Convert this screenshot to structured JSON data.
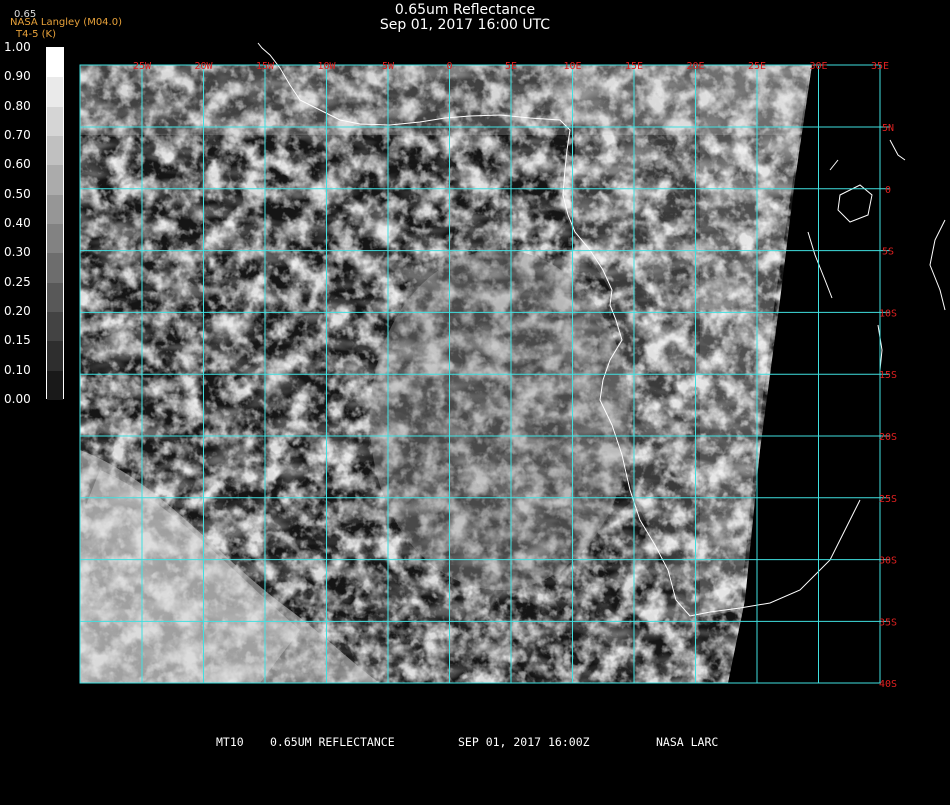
{
  "title": {
    "line1": "0.65um Reflectance",
    "line2": "Sep 01, 2017 16:00 UTC"
  },
  "credit": {
    "agency": "NASA Langley (M04.0)",
    "units": "T4-5 (K)",
    "unit_top": "0.65"
  },
  "colorbar": {
    "labels": [
      "1.00",
      "0.90",
      "0.80",
      "0.70",
      "0.60",
      "0.50",
      "0.40",
      "0.30",
      "0.25",
      "0.20",
      "0.15",
      "0.10",
      "0.00"
    ]
  },
  "longitude_labels": [
    "25W",
    "20W",
    "15W",
    "10W",
    "5W",
    "0",
    "5E",
    "10E",
    "15E",
    "20E",
    "25E",
    "30E",
    "35E"
  ],
  "latitude_labels": [
    "5N",
    "0",
    "5S",
    "10S",
    "15S",
    "20S",
    "25S",
    "30S",
    "35S",
    "40S"
  ],
  "footer": {
    "product": "MT10",
    "band": "0.65UM REFLECTANCE",
    "datetime": "SEP 01, 2017 16:00Z",
    "source": "NASA LARC"
  },
  "colors": {
    "grid": "#40e0e0",
    "grid_label": "#e02020",
    "coastline": "#ffffff",
    "background": "#000000"
  }
}
